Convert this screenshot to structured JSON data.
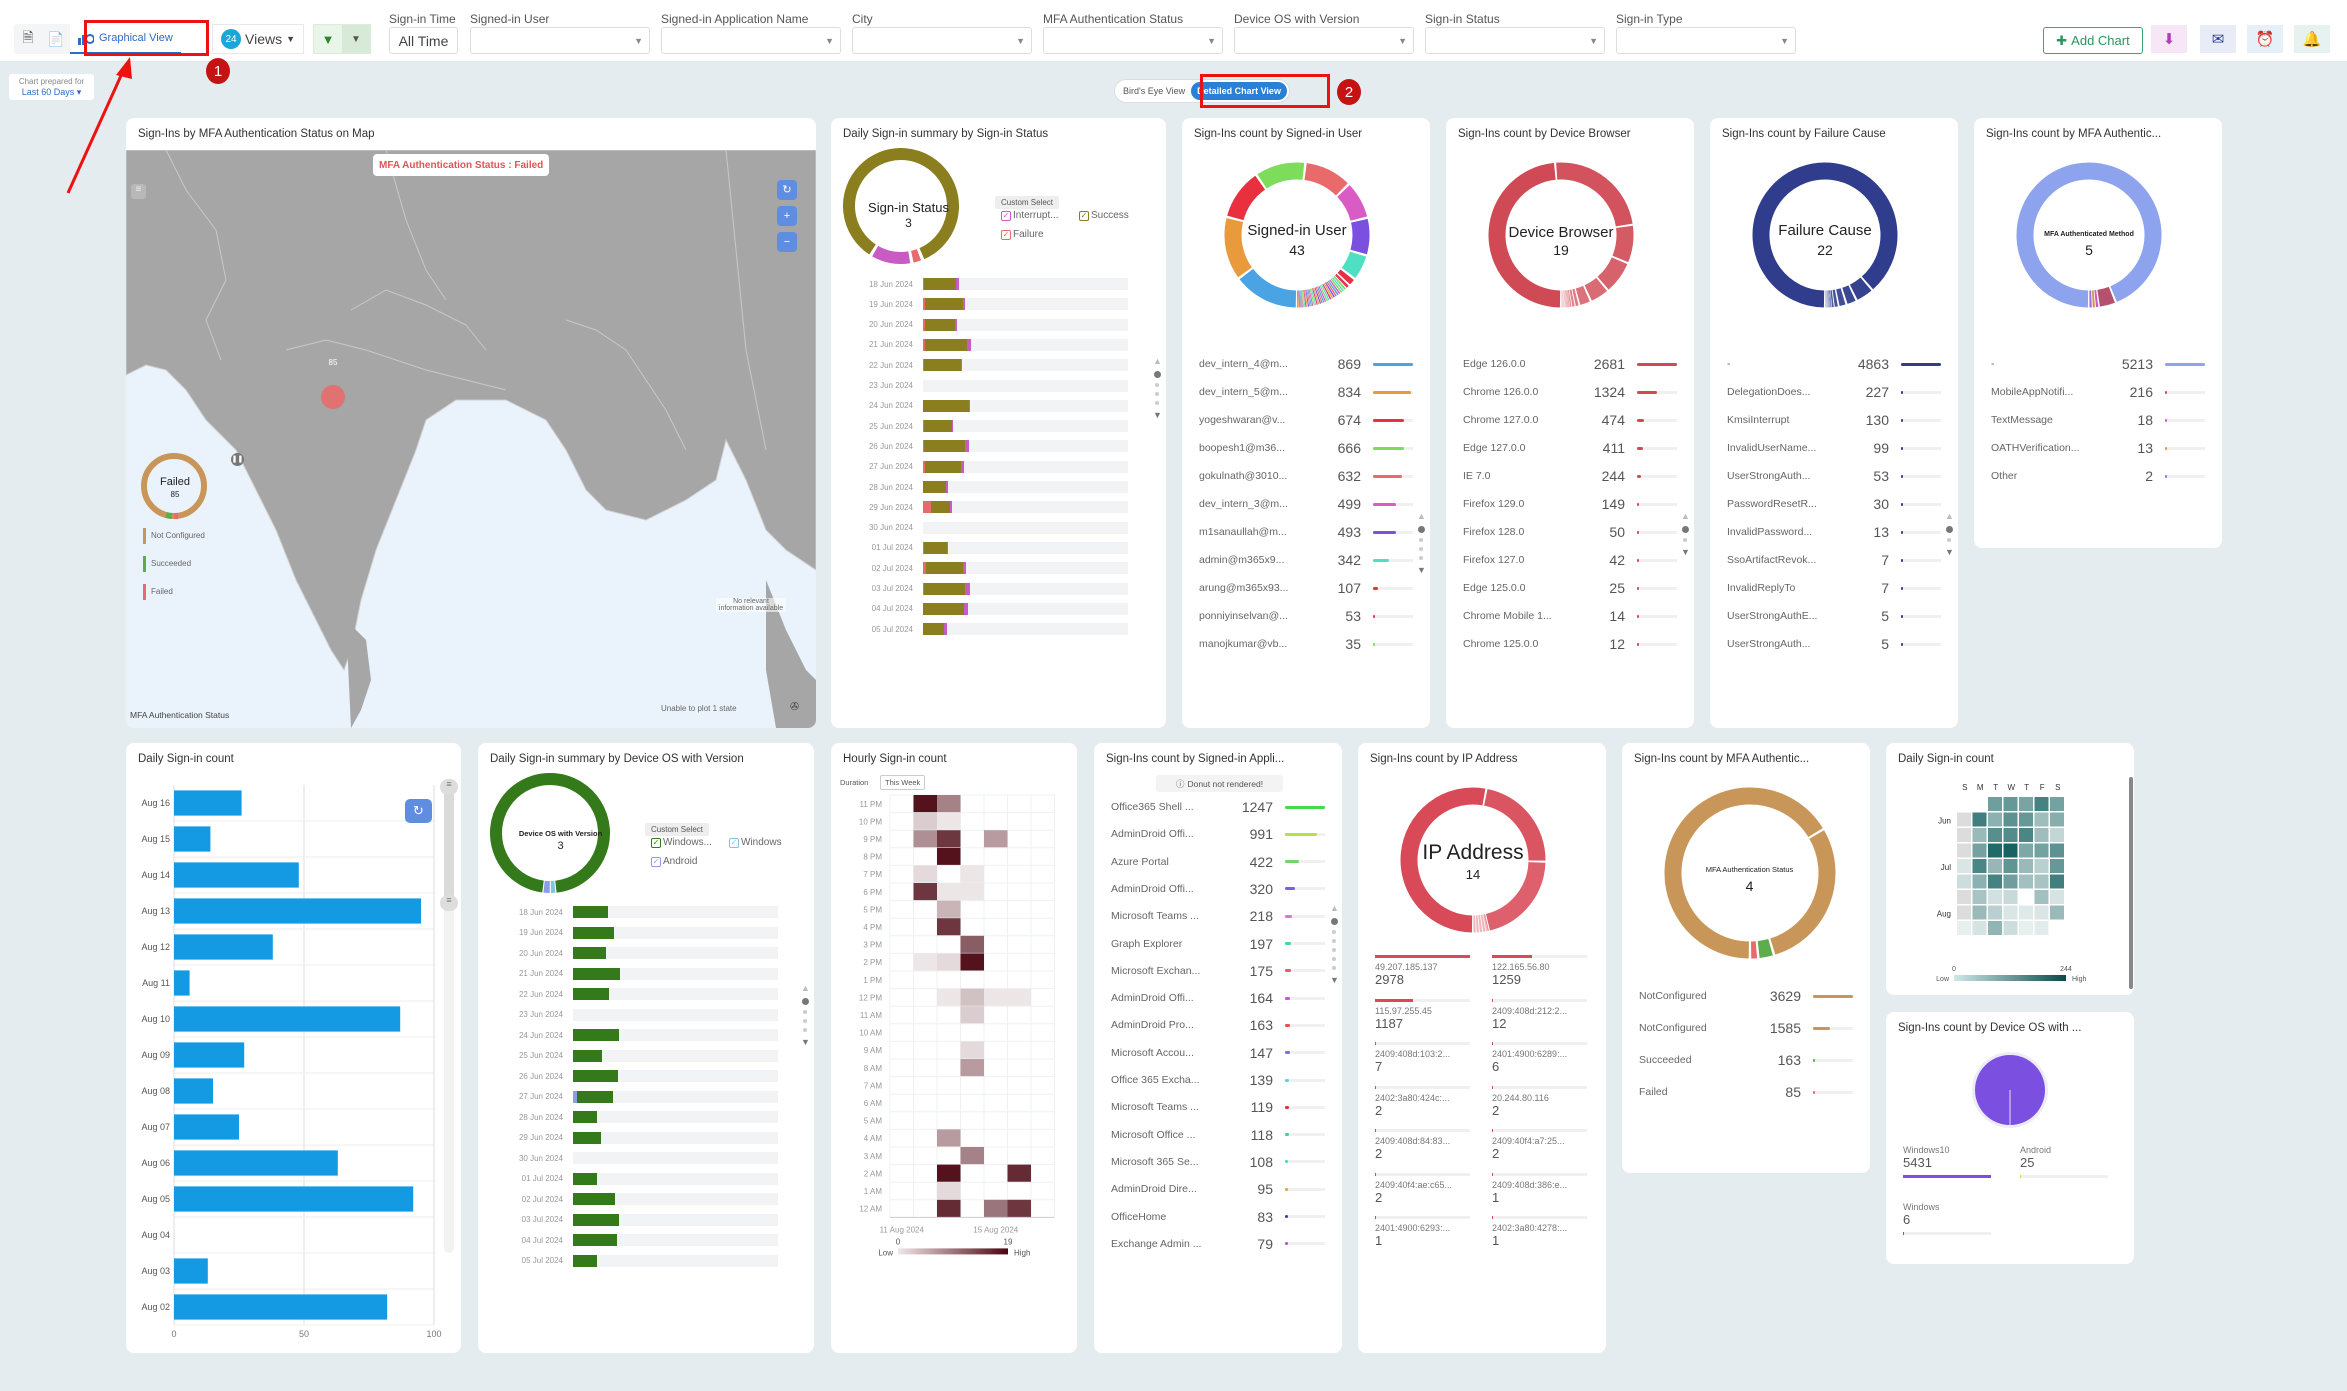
{
  "toolbar": {
    "graphical_view_label": "Graphical View",
    "views_count": "24",
    "views_label": "Views",
    "filters": [
      {
        "label": "Sign-in Time",
        "value": "All Time"
      },
      {
        "label": "Signed-in User",
        "value": ""
      },
      {
        "label": "Signed-in Application Name",
        "value": ""
      },
      {
        "label": "City",
        "value": ""
      },
      {
        "label": "MFA Authentication Status",
        "value": ""
      },
      {
        "label": "Device OS with Version",
        "value": ""
      },
      {
        "label": "Sign-in Status",
        "value": ""
      },
      {
        "label": "Sign-in Type",
        "value": ""
      }
    ],
    "add_chart_label": "Add Chart",
    "colors": {
      "accent": "#2b6cc4",
      "add_chart": "#2e9460",
      "annotation": "#e11111"
    }
  },
  "prepared": {
    "caption": "Chart prepared for",
    "period": "Last 60 Days"
  },
  "view_toggle": {
    "options": [
      "Bird's Eye View",
      "Detailed Chart View"
    ],
    "selected": "Detailed Chart View"
  },
  "annotations": [
    "1",
    "2"
  ],
  "map_card": {
    "title": "Sign-Ins by MFA Authentication Status on Map",
    "tooltip": "MFA Authentication Status : Failed",
    "marker_value": "85",
    "donut": {
      "label": "Failed",
      "value": "85"
    },
    "legend": [
      "Not Configured",
      "Succeeded",
      "Failed"
    ],
    "legend_colors": [
      "#c9965a",
      "#5fac4c",
      "#e96a6a"
    ],
    "legend_title": "MFA Authentication Status",
    "no_info": "No relevant information available",
    "unplotted": "Unable to plot 1 state",
    "unplotted_badge": "1"
  },
  "signin_status_card": {
    "title": "Daily Sign-in summary by Sign-in Status",
    "center_label": "Sign-in Status",
    "center_value": "3",
    "custom_select": "Custom Select",
    "legend": [
      {
        "name": "Interrupt...",
        "color": "#c95bc4"
      },
      {
        "name": "Success",
        "color": "#8a7e1f"
      },
      {
        "name": "Failure",
        "color": "#e96a6a"
      }
    ],
    "rows": [
      {
        "date": "18 Jun 2024",
        "failure": 1,
        "success": 31,
        "interrupt": 3
      },
      {
        "date": "19 Jun 2024",
        "failure": 2,
        "success": 37,
        "interrupt": 2
      },
      {
        "date": "20 Jun 2024",
        "failure": 2,
        "success": 29,
        "interrupt": 2
      },
      {
        "date": "21 Jun 2024",
        "failure": 2,
        "success": 41,
        "interrupt": 4
      },
      {
        "date": "22 Jun 2024",
        "failure": 1,
        "success": 36,
        "interrupt": 1
      },
      {
        "date": "23 Jun 2024",
        "failure": 0,
        "success": 0,
        "interrupt": 0
      },
      {
        "date": "24 Jun 2024",
        "failure": 0,
        "success": 45,
        "interrupt": 1
      },
      {
        "date": "25 Jun 2024",
        "failure": 1,
        "success": 27,
        "interrupt": 1
      },
      {
        "date": "26 Jun 2024",
        "failure": 1,
        "success": 40,
        "interrupt": 4
      },
      {
        "date": "27 Jun 2024",
        "failure": 2,
        "success": 35,
        "interrupt": 3
      },
      {
        "date": "28 Jun 2024",
        "failure": 0,
        "success": 22,
        "interrupt": 2
      },
      {
        "date": "29 Jun 2024",
        "failure": 8,
        "success": 18,
        "interrupt": 2
      },
      {
        "date": "30 Jun 2024",
        "failure": 0,
        "success": 0,
        "interrupt": 0
      },
      {
        "date": "01 Jul 2024",
        "failure": 1,
        "success": 22,
        "interrupt": 1
      },
      {
        "date": "02 Jul 2024",
        "failure": 3,
        "success": 36,
        "interrupt": 3
      },
      {
        "date": "03 Jul 2024",
        "failure": 1,
        "success": 40,
        "interrupt": 5
      },
      {
        "date": "04 Jul 2024",
        "failure": 0,
        "success": 40,
        "interrupt": 4
      },
      {
        "date": "05 Jul 2024",
        "failure": 0,
        "success": 20,
        "interrupt": 3
      }
    ],
    "scale_max": 200
  },
  "user_card": {
    "title": "Sign-Ins count by Signed-in User",
    "center_label": "Signed-in User",
    "center_value": "43",
    "items": [
      {
        "label": "dev_intern_4@m...",
        "value": 869,
        "color": "#4aa3e3"
      },
      {
        "label": "dev_intern_5@m...",
        "value": 834,
        "color": "#e89a3c"
      },
      {
        "label": "yogeshwaran@v...",
        "value": 674,
        "color": "#e8303e"
      },
      {
        "label": "boopesh1@m36...",
        "value": 666,
        "color": "#7ddc5a"
      },
      {
        "label": "gokulnath@3010...",
        "value": 632,
        "color": "#e86a6a"
      },
      {
        "label": "dev_intern_3@m...",
        "value": 499,
        "color": "#d95bc4"
      },
      {
        "label": "m1sanaullah@m...",
        "value": 493,
        "color": "#7b4fe0"
      },
      {
        "label": "admin@m365x9...",
        "value": 342,
        "color": "#4fe0c4"
      },
      {
        "label": "arung@m365x93...",
        "value": 107,
        "color": "#e8303e"
      },
      {
        "label": "ponniyinselvan@...",
        "value": 53,
        "color": "#e8305e"
      },
      {
        "label": "manojkumar@vb...",
        "value": 35,
        "color": "#7ddc5a"
      }
    ]
  },
  "browser_card": {
    "title": "Sign-Ins count by Device Browser",
    "center_label": "Device Browser",
    "center_value": "19",
    "items": [
      {
        "label": "Edge 126.0.0",
        "value": 2681
      },
      {
        "label": "Chrome 126.0.0",
        "value": 1324
      },
      {
        "label": "Chrome 127.0.0",
        "value": 474
      },
      {
        "label": "Edge 127.0.0",
        "value": 411
      },
      {
        "label": "IE 7.0",
        "value": 244
      },
      {
        "label": "Firefox 129.0",
        "value": 149
      },
      {
        "label": "Firefox 128.0",
        "value": 50
      },
      {
        "label": "Firefox 127.0",
        "value": 42
      },
      {
        "label": "Edge 125.0.0",
        "value": 25
      },
      {
        "label": "Chrome Mobile 1...",
        "value": 14
      },
      {
        "label": "Chrome 125.0.0",
        "value": 12
      }
    ],
    "color": "#d04a55"
  },
  "failure_card": {
    "title": "Sign-Ins count by Failure Cause",
    "center_label": "Failure Cause",
    "center_value": "22",
    "items": [
      {
        "label": "-",
        "value": 4863
      },
      {
        "label": "DelegationDoes...",
        "value": 227
      },
      {
        "label": "KmsiInterrupt",
        "value": 130
      },
      {
        "label": "InvalidUserName...",
        "value": 99
      },
      {
        "label": "UserStrongAuth...",
        "value": 53
      },
      {
        "label": "PasswordResetR...",
        "value": 30
      },
      {
        "label": "InvalidPassword...",
        "value": 13
      },
      {
        "label": "SsoArtifactRevok...",
        "value": 7
      },
      {
        "label": "InvalidReplyTo",
        "value": 7
      },
      {
        "label": "UserStrongAuthE...",
        "value": 5
      },
      {
        "label": "UserStrongAuth...",
        "value": 5
      }
    ],
    "color": "#2f3d8c"
  },
  "mfa_method_card": {
    "title": "Sign-Ins count by MFA Authentic...",
    "center_label": "MFA Authenticated Method",
    "center_value": "5",
    "items": [
      {
        "label": "-",
        "value": 5213,
        "color": "#8ea3ee"
      },
      {
        "label": "MobileAppNotifi...",
        "value": 216,
        "color": "#b5506e"
      },
      {
        "label": "TextMessage",
        "value": 18,
        "color": "#c95bc4"
      },
      {
        "label": "OATHVerification...",
        "value": 13,
        "color": "#d19a4a"
      },
      {
        "label": "Other",
        "value": 2,
        "color": "#9b6ee0"
      }
    ]
  },
  "daily_count_card": {
    "title": "Daily Sign-in count",
    "x_ticks": [
      "0",
      "50",
      "100"
    ],
    "rows": [
      {
        "label": "Aug 16",
        "value": 26
      },
      {
        "label": "Aug 15",
        "value": 14
      },
      {
        "label": "Aug 14",
        "value": 48
      },
      {
        "label": "Aug 13",
        "value": 95
      },
      {
        "label": "Aug 12",
        "value": 38
      },
      {
        "label": "Aug 11",
        "value": 6
      },
      {
        "label": "Aug 10",
        "value": 87
      },
      {
        "label": "Aug 09",
        "value": 27
      },
      {
        "label": "Aug 08",
        "value": 15
      },
      {
        "label": "Aug 07",
        "value": 25
      },
      {
        "label": "Aug 06",
        "value": 63
      },
      {
        "label": "Aug 05",
        "value": 92
      },
      {
        "label": "Aug 04",
        "value": 0
      },
      {
        "label": "Aug 03",
        "value": 13
      },
      {
        "label": "Aug 02",
        "value": 82
      }
    ],
    "xmax": 100,
    "color": "#139ae2"
  },
  "device_os_summary_card": {
    "title": "Daily Sign-in summary by Device OS with Version",
    "center_label": "Device OS with Version",
    "center_value": "3",
    "custom_select": "Custom Select",
    "legend": [
      {
        "name": "Windows...",
        "color": "#347a1a"
      },
      {
        "name": "Windows",
        "color": "#7ec6e0"
      },
      {
        "name": "Android",
        "color": "#8e9be6"
      }
    ],
    "rows": [
      {
        "date": "18 Jun 2024",
        "android": 0,
        "windows10": 34
      },
      {
        "date": "19 Jun 2024",
        "android": 0,
        "windows10": 40
      },
      {
        "date": "20 Jun 2024",
        "android": 0,
        "windows10": 32
      },
      {
        "date": "21 Jun 2024",
        "android": 0,
        "windows10": 46
      },
      {
        "date": "22 Jun 2024",
        "android": 0,
        "windows10": 35
      },
      {
        "date": "23 Jun 2024",
        "android": 0,
        "windows10": 0
      },
      {
        "date": "24 Jun 2024",
        "android": 0,
        "windows10": 45
      },
      {
        "date": "25 Jun 2024",
        "android": 0,
        "windows10": 28
      },
      {
        "date": "26 Jun 2024",
        "android": 0,
        "windows10": 44
      },
      {
        "date": "27 Jun 2024",
        "android": 4,
        "windows10": 35
      },
      {
        "date": "28 Jun 2024",
        "android": 0,
        "windows10": 23
      },
      {
        "date": "29 Jun 2024",
        "android": 0,
        "windows10": 27
      },
      {
        "date": "30 Jun 2024",
        "android": 0,
        "windows10": 0
      },
      {
        "date": "01 Jul 2024",
        "android": 0,
        "windows10": 23
      },
      {
        "date": "02 Jul 2024",
        "android": 0,
        "windows10": 41
      },
      {
        "date": "03 Jul 2024",
        "android": 0,
        "windows10": 45
      },
      {
        "date": "04 Jul 2024",
        "android": 0,
        "windows10": 43
      },
      {
        "date": "05 Jul 2024",
        "android": 0,
        "windows10": 23
      }
    ],
    "scale_max": 200
  },
  "hourly_card": {
    "title": "Hourly Sign-in count",
    "duration_label": "Duration",
    "duration_value": "This Week",
    "hours": [
      "11 PM",
      "10 PM",
      "9 PM",
      "8 PM",
      "7 PM",
      "6 PM",
      "5 PM",
      "4 PM",
      "3 PM",
      "2 PM",
      "1 PM",
      "12 PM",
      "11 AM",
      "10 AM",
      "9 AM",
      "8 AM",
      "7 AM",
      "6 AM",
      "5 AM",
      "4 AM",
      "3 AM",
      "2 AM",
      "1 AM",
      "12 AM"
    ],
    "x_labels": [
      "11 Aug 2024",
      "15 Aug 2024"
    ],
    "days": 7,
    "grid": [
      [
        0,
        19,
        10,
        0,
        0,
        0,
        0
      ],
      [
        0,
        4,
        2,
        0,
        0,
        0,
        0
      ],
      [
        0,
        9,
        16,
        0,
        8,
        0,
        0
      ],
      [
        0,
        0,
        19,
        0,
        0,
        0,
        0
      ],
      [
        0,
        3,
        0,
        2,
        0,
        0,
        0
      ],
      [
        0,
        16,
        2,
        2,
        0,
        0,
        0
      ],
      [
        0,
        0,
        6,
        0,
        0,
        0,
        0
      ],
      [
        0,
        0,
        16,
        0,
        0,
        0,
        0
      ],
      [
        0,
        0,
        0,
        13,
        0,
        0,
        0
      ],
      [
        0,
        2,
        3,
        19,
        0,
        0,
        0
      ],
      [
        0,
        0,
        0,
        0,
        0,
        0,
        0
      ],
      [
        0,
        0,
        2,
        5,
        2,
        2,
        0
      ],
      [
        0,
        0,
        0,
        4,
        0,
        0,
        0
      ],
      [
        0,
        0,
        0,
        0,
        0,
        0,
        0
      ],
      [
        0,
        0,
        0,
        3,
        0,
        0,
        0
      ],
      [
        0,
        0,
        0,
        8,
        0,
        0,
        0
      ],
      [
        0,
        0,
        0,
        0,
        0,
        0,
        0
      ],
      [
        0,
        0,
        0,
        0,
        0,
        0,
        0
      ],
      [
        0,
        0,
        0,
        0,
        0,
        0,
        0
      ],
      [
        0,
        0,
        8,
        0,
        0,
        0,
        0
      ],
      [
        0,
        0,
        0,
        10,
        0,
        0,
        0
      ],
      [
        0,
        0,
        19,
        0,
        0,
        17,
        0
      ],
      [
        0,
        0,
        3,
        0,
        0,
        0,
        0
      ],
      [
        0,
        0,
        17,
        0,
        11,
        16,
        0
      ]
    ],
    "scale": {
      "min": "0",
      "max": "19",
      "low": "Low",
      "high": "High"
    }
  },
  "app_card": {
    "title": "Sign-Ins count by Signed-in Appli...",
    "notice": "Donut not rendered!",
    "items": [
      {
        "label": "Office365 Shell ...",
        "value": 1247,
        "color": "#45d84a"
      },
      {
        "label": "AdminDroid Offi...",
        "value": 991,
        "color": "#b5e04a"
      },
      {
        "label": "Azure Portal",
        "value": 422,
        "color": "#6fd86a"
      },
      {
        "label": "AdminDroid Offi...",
        "value": 320,
        "color": "#7b5fe0"
      },
      {
        "label": "Microsoft Teams ...",
        "value": 218,
        "color": "#e070e0"
      },
      {
        "label": "Graph Explorer",
        "value": 197,
        "color": "#3fd8a0"
      },
      {
        "label": "Microsoft Exchan...",
        "value": 175,
        "color": "#e85a6a"
      },
      {
        "label": "AdminDroid Offi...",
        "value": 164,
        "color": "#c950d8"
      },
      {
        "label": "AdminDroid Pro...",
        "value": 163,
        "color": "#e85050"
      },
      {
        "label": "Microsoft Accou...",
        "value": 147,
        "color": "#7b6ee0"
      },
      {
        "label": "Office 365 Excha...",
        "value": 139,
        "color": "#5fd0e0"
      },
      {
        "label": "Microsoft Teams ...",
        "value": 119,
        "color": "#d83040"
      },
      {
        "label": "Microsoft Office ...",
        "value": 118,
        "color": "#3fd88a"
      },
      {
        "label": "Microsoft 365 Se...",
        "value": 108,
        "color": "#3fd8d0"
      },
      {
        "label": "AdminDroid Dire...",
        "value": 95,
        "color": "#e8a040"
      },
      {
        "label": "OfficeHome",
        "value": 83,
        "color": "#3040a0"
      },
      {
        "label": "Exchange Admin ...",
        "value": 79,
        "color": "#d840c0"
      }
    ]
  },
  "ip_card": {
    "title": "Sign-Ins count by IP Address",
    "center_label": "IP Address",
    "center_value": "14",
    "items": [
      {
        "label": "49.207.185.137",
        "value": 2978
      },
      {
        "label": "122.165.56.80",
        "value": 1259
      },
      {
        "label": "115.97.255.45",
        "value": 1187
      },
      {
        "label": "2409:408d:212:2...",
        "value": 12
      },
      {
        "label": "2409:408d:103:2...",
        "value": 7
      },
      {
        "label": "2401:4900:6289:...",
        "value": 6
      },
      {
        "label": "2402:3a80:424c:...",
        "value": 2
      },
      {
        "label": "20.244.80.116",
        "value": 2
      },
      {
        "label": "2409:408d:84:83...",
        "value": 2
      },
      {
        "label": "2409:40f4:a7:25...",
        "value": 2
      },
      {
        "label": "2409:40f4:ae:c65...",
        "value": 2
      },
      {
        "label": "2409:408d:386:e...",
        "value": 1
      },
      {
        "label": "2401:4900:6293:...",
        "value": 1
      },
      {
        "label": "2402:3a80:4278:...",
        "value": 1
      }
    ],
    "color": "#d84a58"
  },
  "mfa_status_card": {
    "title": "Sign-Ins count by MFA Authentic...",
    "center_label": "MFA Authentication Status",
    "center_value": "4",
    "items": [
      {
        "label": "NotConfigured",
        "value": 3629,
        "color": "#c9965a"
      },
      {
        "label": "NotConfigured",
        "value": 1585,
        "color": "#c9965a"
      },
      {
        "label": "Succeeded",
        "value": 163,
        "color": "#5fac4c"
      },
      {
        "label": "Failed",
        "value": 85,
        "color": "#e96a6a"
      }
    ]
  },
  "calendar_card": {
    "title": "Daily Sign-in count",
    "weekdays": [
      "S",
      "M",
      "T",
      "W",
      "T",
      "F",
      "S"
    ],
    "months": [
      "Jun",
      "Jul",
      "Aug"
    ],
    "weeks": [
      [
        null,
        null,
        0.62,
        0.66,
        0.58,
        0.8,
        0.6
      ],
      [
        0,
        0.82,
        0.5,
        0.7,
        0.66,
        0.42,
        0.52
      ],
      [
        0,
        0.44,
        0.72,
        0.74,
        0.78,
        0.42,
        0.26
      ],
      [
        0,
        0.6,
        0.96,
        1.0,
        0.56,
        0.6,
        0.7
      ],
      [
        0.16,
        0.78,
        0.46,
        0.68,
        0.44,
        0.3,
        0.66
      ],
      [
        0.22,
        0.5,
        0.8,
        0.62,
        0.4,
        0.38,
        0.82
      ],
      [
        0,
        0.38,
        0.2,
        0.24,
        null,
        0.4,
        0.18
      ],
      [
        0,
        0.44,
        0.3,
        0.16,
        0.14,
        0.16,
        0.44
      ],
      [
        0.1,
        0.18,
        0.48,
        0.22,
        0.1,
        0.12,
        null
      ]
    ],
    "scale": {
      "min": "0",
      "max": "244",
      "low": "Low",
      "high": "High"
    }
  },
  "os_count_card": {
    "title": "Sign-Ins count by Device OS with ...",
    "items": [
      {
        "label": "Windows10",
        "value": 5431,
        "color": "#7b4fe0"
      },
      {
        "label": "Android",
        "value": 25,
        "color": "#e0d44a"
      },
      {
        "label": "Windows",
        "value": 6,
        "color": "#7b4fe0"
      }
    ]
  }
}
